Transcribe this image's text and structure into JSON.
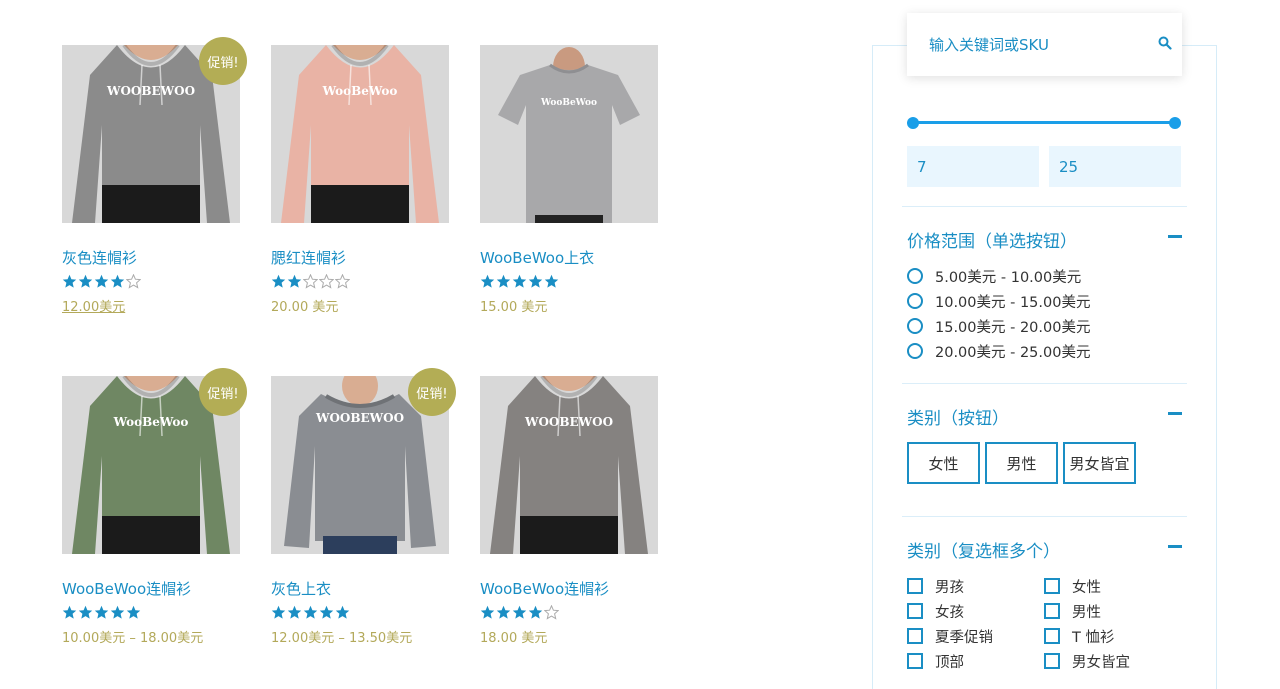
{
  "colors": {
    "accent": "#1a8ec4",
    "sale_badge": "#b3ad55",
    "price": "#b3a95a",
    "star": "#1a8ec4"
  },
  "products": [
    {
      "title": "灰色连帽衫",
      "rating": 4,
      "price": "12.00美元",
      "sale_badge": "促销!",
      "garment": "hoodie",
      "color": "#8b8b8b",
      "print": "WOOBEWOO"
    },
    {
      "title": "腮红连帽衫",
      "rating": 2,
      "price": "20.00 美元",
      "sale_badge": "",
      "garment": "hoodie",
      "color": "#e9b3a5",
      "print": "WooBeWoo"
    },
    {
      "title": "WooBeWoo上衣",
      "rating": 5,
      "price": "15.00 美元",
      "sale_badge": "",
      "garment": "tshirt",
      "color": "#a8a8aa",
      "print": "WooBeWoo"
    },
    {
      "title": "WooBeWoo连帽衫",
      "rating": 5,
      "price": "10.00美元 – 18.00美元",
      "sale_badge": "促销!",
      "garment": "hoodie",
      "color": "#6f8763",
      "print": "WooBeWoo"
    },
    {
      "title": "灰色上衣",
      "rating": 5,
      "price": "12.00美元 – 13.50美元",
      "sale_badge": "促销!",
      "garment": "sweater",
      "color": "#8a8d92",
      "print": "WOOBEWOO"
    },
    {
      "title": "WooBeWoo连帽衫",
      "rating": 4,
      "price": "18.00 美元",
      "sale_badge": "",
      "garment": "hoodie",
      "color": "#858280",
      "print": "WOOBEWOO"
    }
  ],
  "sidebar": {
    "search_placeholder": "输入关键词或SKU",
    "price_min": "7",
    "price_max": "25",
    "price_range": {
      "title": "价格范围（单选按钮）",
      "options": [
        "5.00美元 - 10.00美元",
        "10.00美元 - 15.00美元",
        "15.00美元 - 20.00美元",
        "20.00美元 - 25.00美元"
      ]
    },
    "category_buttons": {
      "title": "类别（按钮）",
      "options": [
        "女性",
        "男性",
        "男女皆宜"
      ]
    },
    "category_checkboxes": {
      "title": "类别（复选框多个）",
      "left": [
        "男孩",
        "女孩",
        "夏季促销",
        "顶部"
      ],
      "right": [
        "女性",
        "男性",
        "T 恤衫",
        "男女皆宜"
      ]
    }
  }
}
